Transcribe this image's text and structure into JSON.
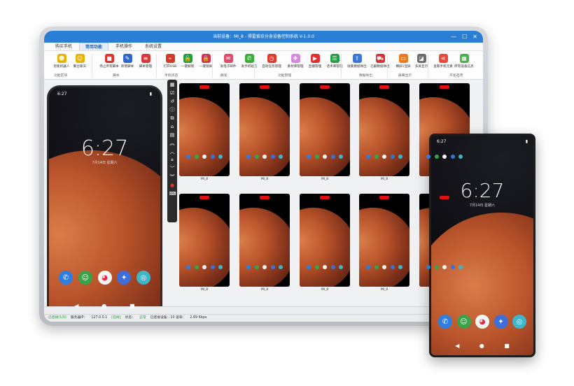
{
  "window": {
    "title": "当前设备：MI_8 - 得雷爱玖分身设备控制系统 V-1.0.0",
    "min": "—",
    "max": "☐",
    "close": "✕"
  },
  "menu_tabs": [
    {
      "label": "购买手机"
    },
    {
      "label": "常用功能"
    },
    {
      "label": "手机操作"
    },
    {
      "label": "系统设置"
    }
  ],
  "ribbon": {
    "buttons": [
      {
        "label": "智能机器人",
        "icon": "robot-icon",
        "color": "#e8b300",
        "glyph": "☻"
      },
      {
        "label": "聚台聊天",
        "icon": "chat-icon",
        "color": "#e8b300",
        "glyph": "☺"
      },
      {
        "label": "停止所有脚本",
        "icon": "stop-icon",
        "color": "#e8302a",
        "glyph": "■"
      },
      {
        "label": "新增脚本",
        "icon": "edit-icon",
        "color": "#2f66c9",
        "glyph": "✎"
      },
      {
        "label": "脚本管理",
        "icon": "list-icon",
        "color": "#d93838",
        "glyph": "≡"
      },
      {
        "label": "打开USB",
        "icon": "usb-icon",
        "color": "#d23b2b",
        "glyph": "⌁"
      },
      {
        "label": "一键解锁",
        "icon": "unlock-icon",
        "color": "#23a03a",
        "glyph": "🔓"
      },
      {
        "label": "一键锁屏",
        "icon": "lock-icon",
        "color": "#d4314c",
        "glyph": "🔒"
      },
      {
        "label": "发电子邮件",
        "icon": "mail-icon",
        "color": "#e24a6a",
        "glyph": "✉"
      },
      {
        "label": "发手机短信",
        "icon": "sms-icon",
        "color": "#3cae3c",
        "glyph": "✆"
      },
      {
        "label": "自动任务管理",
        "icon": "task-icon",
        "color": "#e23b2b",
        "glyph": "◷"
      },
      {
        "label": "素材库管理",
        "icon": "material-icon",
        "color": "#d58ae0",
        "glyph": "❖"
      },
      {
        "label": "直播管理",
        "icon": "live-icon",
        "color": "#e23030",
        "glyph": "▶"
      },
      {
        "label": "话术库管理",
        "icon": "speech-icon",
        "color": "#27a045",
        "glyph": "☰"
      },
      {
        "label": "收集数据导出",
        "icon": "export-icon",
        "color": "#3978d6",
        "glyph": "⇪"
      },
      {
        "label": "已删数据导出",
        "icon": "deleted-icon",
        "color": "#d03434",
        "glyph": "⛟"
      },
      {
        "label": "横屏1显屏",
        "icon": "screen-icon",
        "color": "#f07a1e",
        "glyph": "▭"
      },
      {
        "label": "多屏显示",
        "icon": "multiscreen-icon",
        "color": "#6b6b6b",
        "glyph": "◪"
      },
      {
        "label": "查看手机元素",
        "icon": "share-icon",
        "color": "#e84b3a",
        "glyph": "⋖"
      },
      {
        "label": "所有设备信息",
        "icon": "grid-icon",
        "color": "#4caf50",
        "glyph": "▦"
      }
    ],
    "groups": [
      "功能区块",
      "脚本",
      "手机状态",
      "群发",
      "功能管理",
      "数据导出",
      "屏幕显示",
      "开发选项"
    ]
  },
  "big_phone": {
    "time": "6:27",
    "clock": "6:27",
    "date": "7月14日 星期六",
    "battery": "▮"
  },
  "vertical_toolbar": [
    {
      "icon": "apps-icon",
      "glyph": "▦"
    },
    {
      "icon": "checkbox-icon",
      "glyph": "☑"
    },
    {
      "icon": "history-icon",
      "glyph": "↺"
    },
    {
      "icon": "info-icon",
      "glyph": "ⓘ"
    },
    {
      "icon": "copy-icon",
      "glyph": "⧉"
    },
    {
      "icon": "home-icon",
      "glyph": "⌂"
    },
    {
      "icon": "message-icon",
      "glyph": "▤"
    },
    {
      "icon": "double-up-icon",
      "glyph": "︽"
    },
    {
      "icon": "up-icon",
      "glyph": "︿"
    },
    {
      "icon": "crop-icon",
      "glyph": "⌗"
    },
    {
      "icon": "down-icon",
      "glyph": "﹀"
    },
    {
      "icon": "double-down-icon",
      "glyph": "︾"
    },
    {
      "icon": "record-icon",
      "glyph": "●"
    },
    {
      "icon": "keyboard-icon",
      "glyph": "⌨"
    }
  ],
  "thumbnails": [
    {
      "label": "MI_8"
    },
    {
      "label": "MI_8"
    },
    {
      "label": "MI_8"
    },
    {
      "label": "MI_8"
    },
    {
      "label": "MI_8"
    },
    {
      "label": "MI_8"
    },
    {
      "label": "MI_8"
    },
    {
      "label": "MI_8"
    },
    {
      "label": "MI_8"
    },
    {
      "label": "MI_8"
    }
  ],
  "status_bar": {
    "online": "已连接(1/0)",
    "server_label": "服务器IP：",
    "server_ip": "127.0.0.1",
    "server_state": "[在线]",
    "state_label": "状态：",
    "state_value": "正常",
    "devices": "已连接设备：10 速率：",
    "speed": "2.69 Kbps"
  },
  "right_phone": {
    "time": "6:27",
    "clock": "6:27",
    "date": "7月14日 星期六"
  },
  "dock_apps": [
    {
      "icon": "phone-app-icon",
      "color": "#2f7de1",
      "glyph": "✆"
    },
    {
      "icon": "contacts-app-icon",
      "color": "#3aa34a",
      "glyph": "☺"
    },
    {
      "icon": "gallery-app-icon",
      "color": "#f4f4f4",
      "glyph": "◕"
    },
    {
      "icon": "browser-app-icon",
      "color": "#3e6fd8",
      "glyph": "✦"
    },
    {
      "icon": "camera-app-icon",
      "color": "#3fb5c9",
      "glyph": "◎"
    }
  ]
}
